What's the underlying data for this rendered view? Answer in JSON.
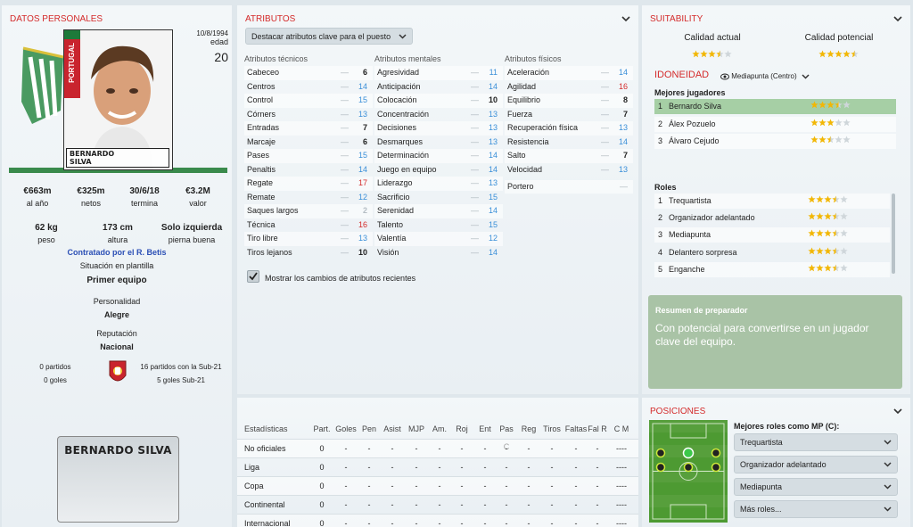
{
  "personal": {
    "title": "DATOS PERSONALES",
    "name_badge": "BERNARDO SILVA",
    "photo_caption_line1": "BERNARDO",
    "photo_caption_line2": "SILVA",
    "flag_label": "PORTUGAL",
    "dob": "10/8/1994",
    "age_label": "edad",
    "age": "20",
    "salary": "€663m",
    "salary_label": "al año",
    "net": "€325m",
    "net_label": "netos",
    "contract_end": "30/6/18",
    "contract_label": "termina",
    "value": "€3.2M",
    "value_label": "valor",
    "weight": "62 kg",
    "weight_label": "peso",
    "height": "173 cm",
    "height_label": "altura",
    "foot": "Solo izquierda",
    "foot_label": "pierna buena",
    "contracted_by": "Contratado por el R. Betis",
    "squad_status_label": "Situación en plantilla",
    "squad_status": "Primer equipo",
    "personality_label": "Personalidad",
    "personality": "Alegre",
    "reputation_label": "Reputación",
    "reputation": "Nacional",
    "caps": "0 partidos",
    "goals": "0 goles",
    "u21_caps": "16 partidos con la Sub-21",
    "u21_goals": "5 goles Sub-21"
  },
  "attributes": {
    "title": "ATRIBUTOS",
    "highlight_dropdown": "Destacar atributos clave para el puesto",
    "tech_header": "Atributos técnicos",
    "mental_header": "Atributos mentales",
    "phys_header": "Atributos físicos",
    "technical": [
      {
        "name": "Cabeceo",
        "value": "6",
        "color": "#222"
      },
      {
        "name": "Centros",
        "value": "14",
        "color": "#3a8fd8"
      },
      {
        "name": "Control",
        "value": "15",
        "color": "#3a8fd8"
      },
      {
        "name": "Córners",
        "value": "13",
        "color": "#3a8fd8"
      },
      {
        "name": "Entradas",
        "value": "7",
        "color": "#222"
      },
      {
        "name": "Marcaje",
        "value": "6",
        "color": "#222"
      },
      {
        "name": "Pases",
        "value": "15",
        "color": "#3a8fd8"
      },
      {
        "name": "Penaltis",
        "value": "14",
        "color": "#3a8fd8"
      },
      {
        "name": "Regate",
        "value": "17",
        "color": "#d42b2b"
      },
      {
        "name": "Remate",
        "value": "12",
        "color": "#3a8fd8"
      },
      {
        "name": "Saques largos",
        "value": "2",
        "color": "#b5bec4"
      },
      {
        "name": "Técnica",
        "value": "16",
        "color": "#d42b2b"
      },
      {
        "name": "Tiro libre",
        "value": "13",
        "color": "#3a8fd8"
      },
      {
        "name": "Tiros lejanos",
        "value": "10",
        "color": "#222"
      }
    ],
    "mental": [
      {
        "name": "Agresividad",
        "value": "11",
        "color": "#3a8fd8"
      },
      {
        "name": "Anticipación",
        "value": "14",
        "color": "#3a8fd8"
      },
      {
        "name": "Colocación",
        "value": "10",
        "color": "#222"
      },
      {
        "name": "Concentración",
        "value": "13",
        "color": "#3a8fd8"
      },
      {
        "name": "Decisiones",
        "value": "13",
        "color": "#3a8fd8"
      },
      {
        "name": "Desmarques",
        "value": "13",
        "color": "#3a8fd8"
      },
      {
        "name": "Determinación",
        "value": "14",
        "color": "#3a8fd8"
      },
      {
        "name": "Juego en equipo",
        "value": "14",
        "color": "#3a8fd8"
      },
      {
        "name": "Liderazgo",
        "value": "13",
        "color": "#3a8fd8"
      },
      {
        "name": "Sacrificio",
        "value": "15",
        "color": "#3a8fd8"
      },
      {
        "name": "Serenidad",
        "value": "14",
        "color": "#3a8fd8"
      },
      {
        "name": "Talento",
        "value": "15",
        "color": "#3a8fd8"
      },
      {
        "name": "Valentía",
        "value": "12",
        "color": "#3a8fd8"
      },
      {
        "name": "Visión",
        "value": "14",
        "color": "#3a8fd8"
      }
    ],
    "physical": [
      {
        "name": "Aceleración",
        "value": "14",
        "color": "#3a8fd8"
      },
      {
        "name": "Agilidad",
        "value": "16",
        "color": "#d42b2b"
      },
      {
        "name": "Equilibrio",
        "value": "8",
        "color": "#222"
      },
      {
        "name": "Fuerza",
        "value": "7",
        "color": "#222"
      },
      {
        "name": "Recuperación física",
        "value": "13",
        "color": "#3a8fd8"
      },
      {
        "name": "Resistencia",
        "value": "14",
        "color": "#3a8fd8"
      },
      {
        "name": "Salto",
        "value": "7",
        "color": "#222"
      },
      {
        "name": "Velocidad",
        "value": "13",
        "color": "#3a8fd8"
      }
    ],
    "goalkeeper_label": "Portero",
    "recent_changes_label": "Mostrar los cambios de atributos recientes"
  },
  "stats": {
    "headers": [
      "Estadísticas",
      "Part.",
      "Goles",
      "Pen",
      "Asist",
      "MJP",
      "Am.",
      "Roj",
      "Ent",
      "Pas C",
      "Reg",
      "Tiros",
      "Faltas",
      "Fal R",
      "C M"
    ],
    "rows": [
      {
        "cells": [
          "No oficiales",
          "0",
          "-",
          "-",
          "-",
          "-",
          "-",
          "-",
          "-",
          "-",
          "-",
          "-",
          "-",
          "-",
          "----"
        ]
      },
      {
        "cells": [
          "Liga",
          "0",
          "-",
          "-",
          "-",
          "-",
          "-",
          "-",
          "-",
          "-",
          "-",
          "-",
          "-",
          "-",
          "----"
        ]
      },
      {
        "cells": [
          "Copa",
          "0",
          "-",
          "-",
          "-",
          "-",
          "-",
          "-",
          "-",
          "-",
          "-",
          "-",
          "-",
          "-",
          "----"
        ]
      },
      {
        "cells": [
          "Continental",
          "0",
          "-",
          "-",
          "-",
          "-",
          "-",
          "-",
          "-",
          "-",
          "-",
          "-",
          "-",
          "-",
          "----"
        ]
      },
      {
        "cells": [
          "Internacional",
          "0",
          "-",
          "-",
          "-",
          "-",
          "-",
          "-",
          "-",
          "-",
          "-",
          "-",
          "-",
          "-",
          "----"
        ]
      }
    ]
  },
  "suitability": {
    "title": "SUITABILITY",
    "current_label": "Calidad actual",
    "potential_label": "Calidad potencial",
    "current_stars": 3.5,
    "potential_stars": 4.5,
    "idoneidad_label": "IDONEIDAD",
    "position_dropdown": "Mediapunta (Centro)",
    "best_players_label": "Mejores jugadores",
    "best_players": [
      {
        "rank": "1",
        "name": "Bernardo Silva",
        "stars": 3.5
      },
      {
        "rank": "2",
        "name": "Álex Pozuelo",
        "stars": 3
      },
      {
        "rank": "3",
        "name": "Álvaro Cejudo",
        "stars": 2.5
      }
    ],
    "roles_label": "Roles",
    "roles": [
      {
        "rank": "1",
        "name": "Trequartista",
        "stars": 3.5
      },
      {
        "rank": "2",
        "name": "Organizador adelantado",
        "stars": 3.5
      },
      {
        "rank": "3",
        "name": "Mediapunta",
        "stars": 3.5
      },
      {
        "rank": "4",
        "name": "Delantero sorpresa",
        "stars": 3.5
      },
      {
        "rank": "5",
        "name": "Enganche",
        "stars": 3.5
      }
    ],
    "coach_title": "Resumen de preparador",
    "coach_text": "Con potencial para convertirse en un jugador clave del equipo."
  },
  "positions": {
    "title": "POSICIONES",
    "best_roles_label": "Mejores roles como MP (C):",
    "roles": [
      "Trequartista",
      "Organizador adelantado",
      "Mediapunta",
      "Más roles..."
    ]
  },
  "colors": {
    "accent": "#d42b2b",
    "blue": "#3a8fd8",
    "star": "#f2b705",
    "pitch": "#4d9a32"
  }
}
